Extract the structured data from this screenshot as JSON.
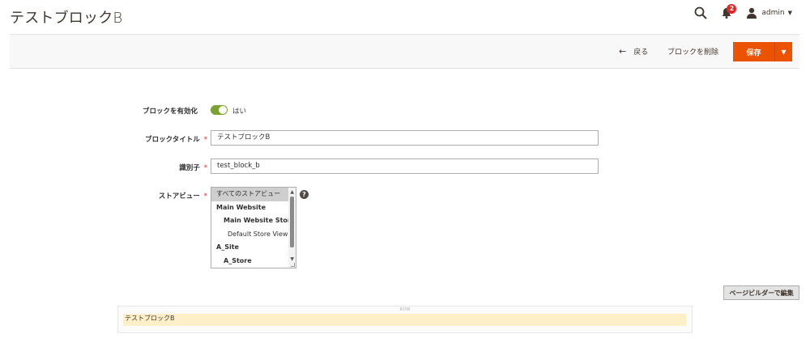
{
  "header": {
    "title": "テストブロックB",
    "notification_count": "2",
    "user_label": "admin"
  },
  "actions": {
    "back_label": "戻る",
    "delete_label": "ブロックを削除",
    "save_label": "保存"
  },
  "form": {
    "enable": {
      "label": "ブロックを有効化",
      "value_text": "はい",
      "enabled": true
    },
    "title": {
      "label": "ブロックタイトル",
      "value": "テストブロックB"
    },
    "identifier": {
      "label": "識別子",
      "value": "test_block_b"
    },
    "store_view": {
      "label": "ストアビュー",
      "options": [
        {
          "text": "すべてのストアビュー",
          "selected": true
        },
        {
          "text": "Main Website"
        },
        {
          "text": "Main Website Store"
        },
        {
          "text": "Default Store View"
        },
        {
          "text": "A_Site"
        },
        {
          "text": "A_Store"
        }
      ]
    },
    "help_icon_text": "?"
  },
  "page_builder": {
    "edit_button_label": "ページビルダーで編集",
    "row_label": "ROW",
    "content_text": "テストブロックB"
  },
  "colors": {
    "accent": "#eb5202",
    "toggle_on": "#79a22e",
    "required": "#e22626"
  }
}
